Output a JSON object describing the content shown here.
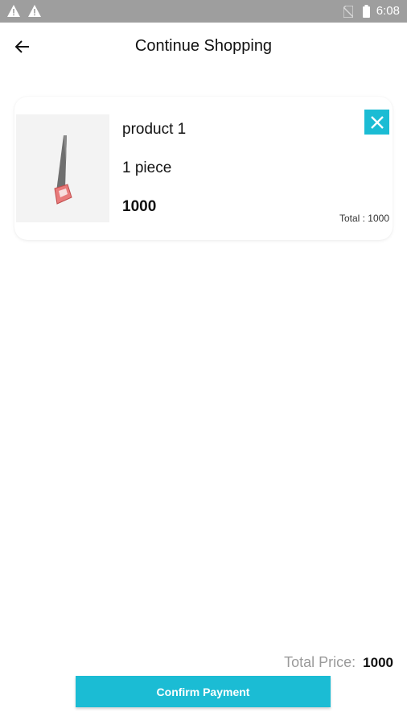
{
  "status_bar": {
    "time": "6:08",
    "icons": [
      "warning-icon",
      "warning-icon",
      "no-sim-icon",
      "battery-icon"
    ]
  },
  "app_bar": {
    "title": "Continue Shopping",
    "back_icon": "arrow-left-icon"
  },
  "cart": {
    "items": [
      {
        "name": "product 1",
        "quantity": "1  piece",
        "price": "1000",
        "line_total": "Total : 1000",
        "image": "hand-saw",
        "remove_icon": "close-icon"
      }
    ]
  },
  "summary": {
    "total_label": "Total Price:",
    "total_value": "1000"
  },
  "actions": {
    "confirm_label": "Confirm Payment"
  },
  "colors": {
    "accent": "#1bbcd4",
    "status_bar": "#9e9e9e",
    "thumb_bg": "#f3f3f3"
  }
}
